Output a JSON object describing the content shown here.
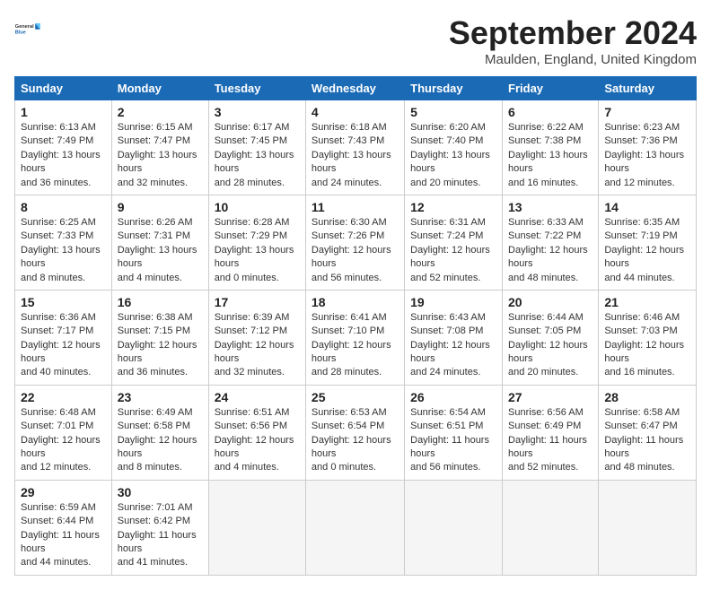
{
  "header": {
    "logo_line1": "General",
    "logo_line2": "Blue",
    "month": "September 2024",
    "location": "Maulden, England, United Kingdom"
  },
  "days_of_week": [
    "Sunday",
    "Monday",
    "Tuesday",
    "Wednesday",
    "Thursday",
    "Friday",
    "Saturday"
  ],
  "weeks": [
    [
      {
        "num": "1",
        "rise": "6:13 AM",
        "set": "7:49 PM",
        "daylight": "13 hours and 36 minutes."
      },
      {
        "num": "2",
        "rise": "6:15 AM",
        "set": "7:47 PM",
        "daylight": "13 hours and 32 minutes."
      },
      {
        "num": "3",
        "rise": "6:17 AM",
        "set": "7:45 PM",
        "daylight": "13 hours and 28 minutes."
      },
      {
        "num": "4",
        "rise": "6:18 AM",
        "set": "7:43 PM",
        "daylight": "13 hours and 24 minutes."
      },
      {
        "num": "5",
        "rise": "6:20 AM",
        "set": "7:40 PM",
        "daylight": "13 hours and 20 minutes."
      },
      {
        "num": "6",
        "rise": "6:22 AM",
        "set": "7:38 PM",
        "daylight": "13 hours and 16 minutes."
      },
      {
        "num": "7",
        "rise": "6:23 AM",
        "set": "7:36 PM",
        "daylight": "13 hours and 12 minutes."
      }
    ],
    [
      {
        "num": "8",
        "rise": "6:25 AM",
        "set": "7:33 PM",
        "daylight": "13 hours and 8 minutes."
      },
      {
        "num": "9",
        "rise": "6:26 AM",
        "set": "7:31 PM",
        "daylight": "13 hours and 4 minutes."
      },
      {
        "num": "10",
        "rise": "6:28 AM",
        "set": "7:29 PM",
        "daylight": "13 hours and 0 minutes."
      },
      {
        "num": "11",
        "rise": "6:30 AM",
        "set": "7:26 PM",
        "daylight": "12 hours and 56 minutes."
      },
      {
        "num": "12",
        "rise": "6:31 AM",
        "set": "7:24 PM",
        "daylight": "12 hours and 52 minutes."
      },
      {
        "num": "13",
        "rise": "6:33 AM",
        "set": "7:22 PM",
        "daylight": "12 hours and 48 minutes."
      },
      {
        "num": "14",
        "rise": "6:35 AM",
        "set": "7:19 PM",
        "daylight": "12 hours and 44 minutes."
      }
    ],
    [
      {
        "num": "15",
        "rise": "6:36 AM",
        "set": "7:17 PM",
        "daylight": "12 hours and 40 minutes."
      },
      {
        "num": "16",
        "rise": "6:38 AM",
        "set": "7:15 PM",
        "daylight": "12 hours and 36 minutes."
      },
      {
        "num": "17",
        "rise": "6:39 AM",
        "set": "7:12 PM",
        "daylight": "12 hours and 32 minutes."
      },
      {
        "num": "18",
        "rise": "6:41 AM",
        "set": "7:10 PM",
        "daylight": "12 hours and 28 minutes."
      },
      {
        "num": "19",
        "rise": "6:43 AM",
        "set": "7:08 PM",
        "daylight": "12 hours and 24 minutes."
      },
      {
        "num": "20",
        "rise": "6:44 AM",
        "set": "7:05 PM",
        "daylight": "12 hours and 20 minutes."
      },
      {
        "num": "21",
        "rise": "6:46 AM",
        "set": "7:03 PM",
        "daylight": "12 hours and 16 minutes."
      }
    ],
    [
      {
        "num": "22",
        "rise": "6:48 AM",
        "set": "7:01 PM",
        "daylight": "12 hours and 12 minutes."
      },
      {
        "num": "23",
        "rise": "6:49 AM",
        "set": "6:58 PM",
        "daylight": "12 hours and 8 minutes."
      },
      {
        "num": "24",
        "rise": "6:51 AM",
        "set": "6:56 PM",
        "daylight": "12 hours and 4 minutes."
      },
      {
        "num": "25",
        "rise": "6:53 AM",
        "set": "6:54 PM",
        "daylight": "12 hours and 0 minutes."
      },
      {
        "num": "26",
        "rise": "6:54 AM",
        "set": "6:51 PM",
        "daylight": "11 hours and 56 minutes."
      },
      {
        "num": "27",
        "rise": "6:56 AM",
        "set": "6:49 PM",
        "daylight": "11 hours and 52 minutes."
      },
      {
        "num": "28",
        "rise": "6:58 AM",
        "set": "6:47 PM",
        "daylight": "11 hours and 48 minutes."
      }
    ],
    [
      {
        "num": "29",
        "rise": "6:59 AM",
        "set": "6:44 PM",
        "daylight": "11 hours and 44 minutes."
      },
      {
        "num": "30",
        "rise": "7:01 AM",
        "set": "6:42 PM",
        "daylight": "11 hours and 41 minutes."
      },
      null,
      null,
      null,
      null,
      null
    ]
  ]
}
